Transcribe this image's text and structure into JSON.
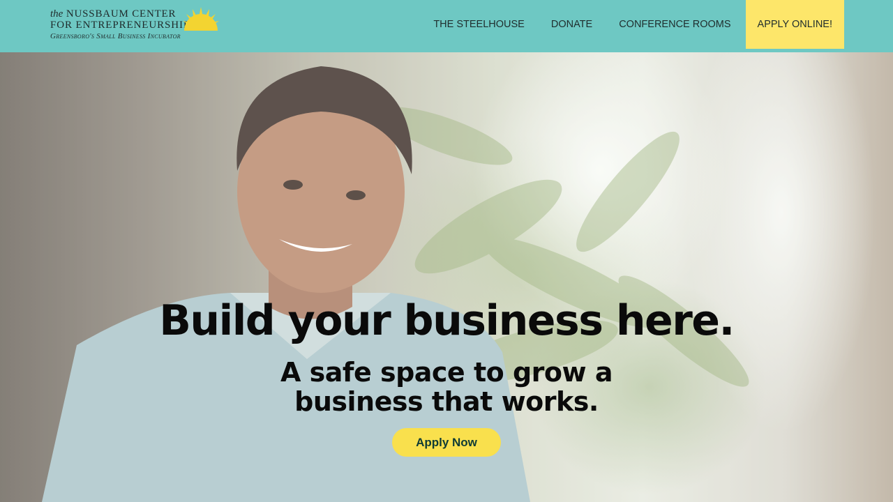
{
  "header": {
    "logo": {
      "prefix": "the",
      "name_line1": "NUSSBAUM CENTER",
      "name_line2": "FOR ENTREPRENEURSHIP",
      "tagline": "Greensboro's Small Business Incubator",
      "icon": "sun-icon"
    },
    "nav": [
      {
        "label": "THE STEELHOUSE"
      },
      {
        "label": "DONATE"
      },
      {
        "label": "CONFERENCE ROOMS"
      },
      {
        "label": "APPLY ONLINE!"
      }
    ]
  },
  "hero": {
    "headline": "Build your business here.",
    "subheadline_line1": "A safe space to grow a",
    "subheadline_line2": "business that works.",
    "button_label": "Apply Now"
  },
  "colors": {
    "header_bg": "#6ec8c3",
    "cta_bg": "#fde66a",
    "button_bg": "#f9e04d",
    "button_text": "#0f3b35"
  }
}
